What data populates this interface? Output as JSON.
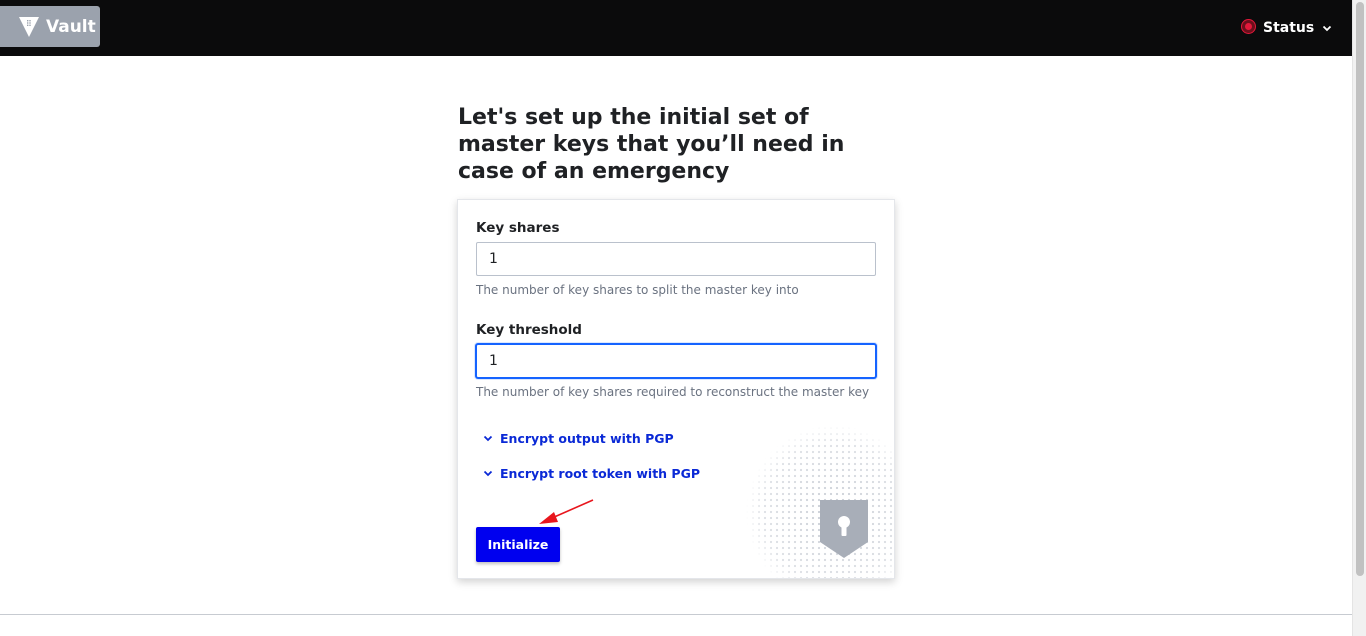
{
  "header": {
    "brand_label": "Vault",
    "status_label": "Status",
    "status_color": "#e3183a"
  },
  "page": {
    "title": "Let's set up the initial set of master keys that you’ll need in case of an emergency"
  },
  "form": {
    "key_shares": {
      "label": "Key shares",
      "value": "1",
      "help": "The number of key shares to split the master key into"
    },
    "key_threshold": {
      "label": "Key threshold",
      "value": "1",
      "help": "The number of key shares required to reconstruct the master key"
    },
    "toggles": [
      {
        "label": "Encrypt output with PGP",
        "icon": "chevron-down-icon"
      },
      {
        "label": "Encrypt root token with PGP",
        "icon": "chevron-down-icon"
      }
    ],
    "submit_label": "Initialize"
  },
  "colors": {
    "primary": "#0000ef",
    "link": "#0a29d6",
    "topbar": "#0b0b0c",
    "annotation_arrow": "#e8161d"
  }
}
